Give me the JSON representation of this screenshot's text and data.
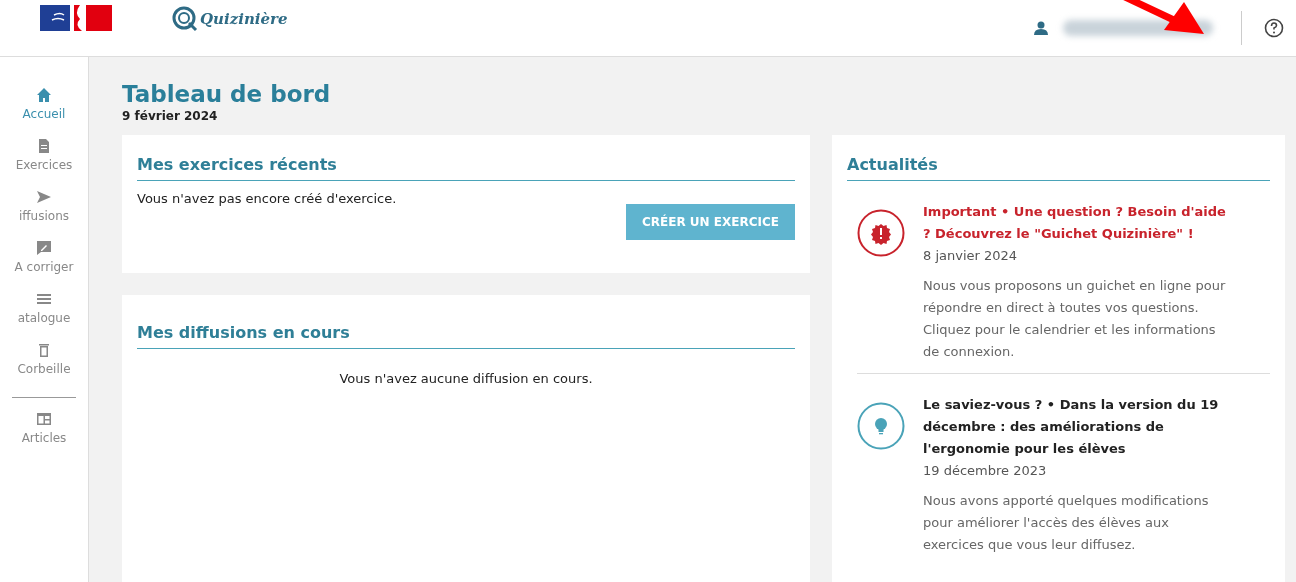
{
  "header": {
    "brand": "Quizinière"
  },
  "sidebar": {
    "items": [
      {
        "label": "Accueil",
        "kind": "home",
        "selected": true
      },
      {
        "label": "Exercices",
        "kind": "file",
        "selected": false
      },
      {
        "label": "iffusions",
        "kind": "send",
        "selected": false
      },
      {
        "label": "A corriger",
        "kind": "edit",
        "selected": false
      },
      {
        "label": "atalogue",
        "kind": "list",
        "selected": false
      },
      {
        "label": "Corbeille",
        "kind": "trash",
        "selected": false
      },
      {
        "label": "Articles",
        "kind": "articles",
        "selected": false,
        "divider_before": true
      }
    ]
  },
  "page": {
    "title": "Tableau de bord",
    "date": "9 février 2024"
  },
  "recent": {
    "title": "Mes exercices récents",
    "empty": "Vous n'avez pas encore créé d'exercice.",
    "button": "CRÉER UN EXERCICE"
  },
  "diffusions": {
    "title": "Mes diffusions en cours",
    "empty": "Vous n'avez aucune diffusion en cours."
  },
  "news": {
    "title": "Actualités",
    "items": [
      {
        "kind": "important",
        "headline": "Important • Une question ? Besoin d'aide ? Découvrez le \"Guichet Quizinière\" !",
        "date": "8 janvier 2024",
        "body": "Nous vous proposons un guichet en ligne pour répondre en direct à toutes vos questions. Cliquez pour le calendrier et les informations de connexion."
      },
      {
        "kind": "tip",
        "headline": "Le saviez-vous ? • Dans la version du 19 décembre : des améliorations de l'ergonomie pour les élèves",
        "date": "19 décembre 2023",
        "body": "Nous avons apporté quelques modifications pour améliorer l'accès des élèves aux exercices que vous leur diffusez."
      }
    ]
  }
}
